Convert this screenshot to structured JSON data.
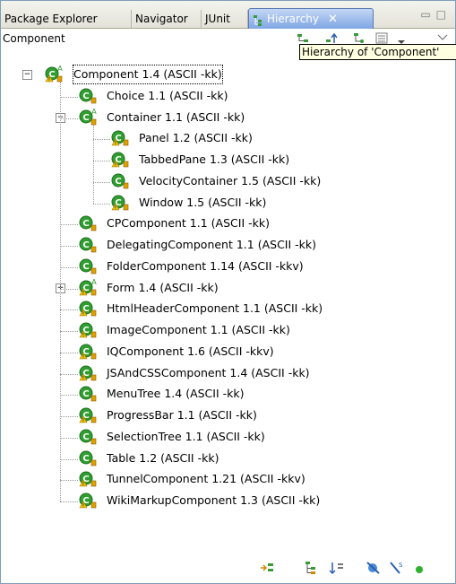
{
  "tabs": [
    {
      "label": "Package Explorer"
    },
    {
      "label": "Navigator"
    },
    {
      "label": "JUnit"
    },
    {
      "label": "Hierarchy",
      "active": true
    }
  ],
  "header": {
    "label": "Component",
    "tooltip": "Hierarchy of 'Component'"
  },
  "tree": [
    {
      "label": "Component  1.4  (ASCII -kk)",
      "icon": "class-warning-abstract",
      "expand": "-",
      "selected": true
    },
    {
      "label": "Choice  1.1  (ASCII -kk)",
      "icon": "class-lock"
    },
    {
      "label": "Container  1.1  (ASCII -kk)",
      "icon": "class-lock-abstract",
      "expand": "-"
    },
    {
      "label": "Panel  1.2  (ASCII -kk)",
      "icon": "class-warning-lock"
    },
    {
      "label": "TabbedPane  1.3  (ASCII -kk)",
      "icon": "class-warning-lock"
    },
    {
      "label": "VelocityContainer  1.5  (ASCII -kk)",
      "icon": "class-lock"
    },
    {
      "label": "Window  1.5  (ASCII -kk)",
      "icon": "class-warning-lock"
    },
    {
      "label": "CPComponent  1.1  (ASCII -kk)",
      "icon": "class-lock"
    },
    {
      "label": "DelegatingComponent  1.1  (ASCII -kk)",
      "icon": "class-lock"
    },
    {
      "label": "FolderComponent  1.14  (ASCII -kkv)",
      "icon": "class-lock"
    },
    {
      "label": "Form  1.4  (ASCII -kk)",
      "icon": "class-warning-lock-abstract",
      "expand": "+"
    },
    {
      "label": "HtmlHeaderComponent  1.1  (ASCII -kk)",
      "icon": "class-warning-lock"
    },
    {
      "label": "ImageComponent  1.1  (ASCII -kk)",
      "icon": "class-warning-lock"
    },
    {
      "label": "IQComponent  1.6  (ASCII -kkv)",
      "icon": "class-warning-lock"
    },
    {
      "label": "JSAndCSSComponent  1.4  (ASCII -kk)",
      "icon": "class-warning-lock"
    },
    {
      "label": "MenuTree  1.4  (ASCII -kk)",
      "icon": "class-lock"
    },
    {
      "label": "ProgressBar  1.1  (ASCII -kk)",
      "icon": "class-warning-lock"
    },
    {
      "label": "SelectionTree  1.1  (ASCII -kk)",
      "icon": "class-lock"
    },
    {
      "label": "Table  1.2  (ASCII -kk)",
      "icon": "class-lock"
    },
    {
      "label": "TunnelComponent  1.21  (ASCII -kkv)",
      "icon": "class-warning-lock"
    },
    {
      "label": "WikiMarkupComponent  1.3  (ASCII -kk)",
      "icon": "class-warning-lock"
    }
  ],
  "toolbar_icons": [
    "show-type-hierarchy-icon",
    "show-supertype-hierarchy-icon",
    "show-subtype-hierarchy-icon",
    "show-all-inherited-icon",
    "hide-fields-icon",
    "hide-static-icon",
    "hide-non-public-icon"
  ],
  "colors": {
    "class_green": "#2f9e2f",
    "warning_yellow": "#f2c200",
    "lock_orange": "#e0a000",
    "active_tab": "#7fa6e3"
  }
}
